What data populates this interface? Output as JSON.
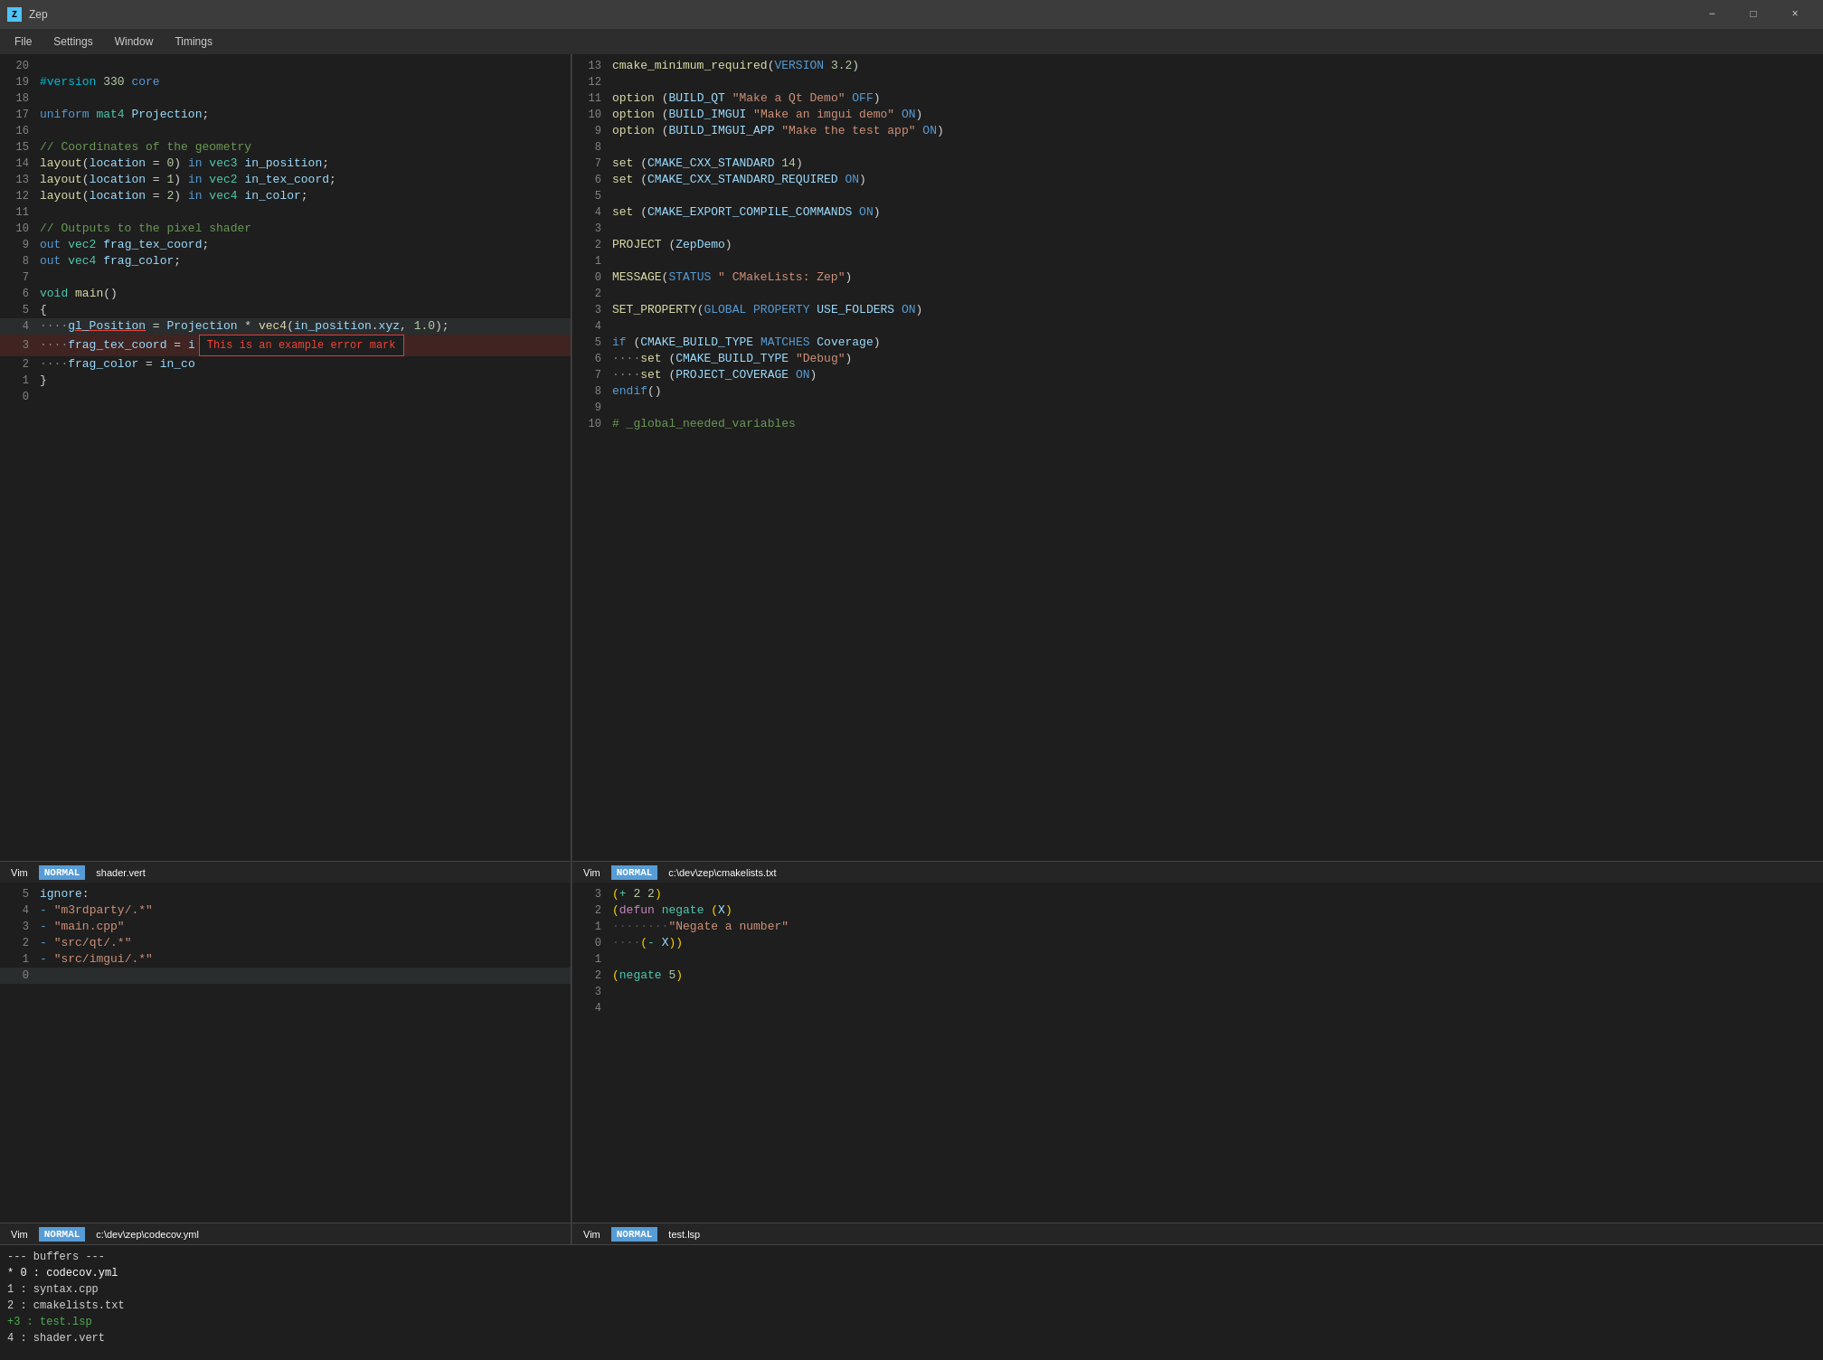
{
  "app": {
    "title": "Zep",
    "icon": "Z"
  },
  "menu": {
    "items": [
      "File",
      "Settings",
      "Window",
      "Timings"
    ]
  },
  "top_left_editor": {
    "lines": [
      {
        "num": "20",
        "content": ""
      },
      {
        "num": "19",
        "content": "#version 330 core",
        "type": "preprocessor"
      },
      {
        "num": "18",
        "content": ""
      },
      {
        "num": "17",
        "content": "uniform mat4 Projection;",
        "type": "code"
      },
      {
        "num": "16",
        "content": ""
      },
      {
        "num": "15",
        "content": "// Coordinates  of the geometry",
        "type": "comment"
      },
      {
        "num": "14",
        "content": "layout(location = 0) in vec3 in_position;",
        "type": "code"
      },
      {
        "num": "13",
        "content": "layout(location = 1) in vec2 in_tex_coord;",
        "type": "code"
      },
      {
        "num": "12",
        "content": "layout(location = 2) in vec4 in_color;",
        "type": "code"
      },
      {
        "num": "11",
        "content": ""
      },
      {
        "num": "10",
        "content": "// Outputs to the pixel shader",
        "type": "comment"
      },
      {
        "num": "9",
        "content": "out vec2 frag_tex_coord;",
        "type": "code"
      },
      {
        "num": "8",
        "content": "out vec4 frag_color;",
        "type": "code"
      },
      {
        "num": "7",
        "content": ""
      },
      {
        "num": "6",
        "content": "void main()",
        "type": "code"
      },
      {
        "num": "5",
        "content": "{",
        "type": "code"
      },
      {
        "num": "4",
        "content": "    gl_Position = Projection * vec4(in_position.xyz, 1.0);",
        "type": "code",
        "highlight": true
      },
      {
        "num": "3",
        "content": "    frag_tex_coord = i",
        "type": "code",
        "error": true,
        "tooltip": "This is an example error mark"
      },
      {
        "num": "2",
        "content": "    frag_color = in_co",
        "type": "code"
      },
      {
        "num": "1",
        "content": "}",
        "type": "code"
      },
      {
        "num": "0",
        "content": ""
      }
    ],
    "status": {
      "vim": "Vim",
      "mode": "NORMAL",
      "filename": "shader.vert"
    }
  },
  "top_right_editor": {
    "lines": [
      {
        "num": "13",
        "content": "cmake_minimum_required(VERSION 3.2)"
      },
      {
        "num": "12",
        "content": ""
      },
      {
        "num": "11",
        "content": "option (BUILD_QT \"Make a Qt Demo\" OFF)"
      },
      {
        "num": "10",
        "content": "option (BUILD_IMGUI \"Make an imgui demo\" ON)"
      },
      {
        "num": "9",
        "content": "option (BUILD_IMGUI_APP \"Make the test app\" ON)"
      },
      {
        "num": "8",
        "content": ""
      },
      {
        "num": "7",
        "content": "set (CMAKE_CXX_STANDARD 14)"
      },
      {
        "num": "6",
        "content": "set (CMAKE_CXX_STANDARD_REQUIRED ON)"
      },
      {
        "num": "5",
        "content": ""
      },
      {
        "num": "4",
        "content": "set (CMAKE_EXPORT_COMPILE_COMMANDS ON)"
      },
      {
        "num": "3",
        "content": ""
      },
      {
        "num": "2",
        "content": "PROJECT (ZepDemo)"
      },
      {
        "num": "1",
        "content": ""
      },
      {
        "num": "0",
        "content": "MESSAGE(STATUS \" CMakeLists: Zep\")"
      },
      {
        "num": "2",
        "content": ""
      },
      {
        "num": "3",
        "content": "SET_PROPERTY(GLOBAL PROPERTY USE_FOLDERS ON)"
      },
      {
        "num": "4",
        "content": ""
      },
      {
        "num": "5",
        "content": "if (CMAKE_BUILD_TYPE MATCHES Coverage)"
      },
      {
        "num": "6",
        "content": "    set (CMAKE_BUILD_TYPE \"Debug\")"
      },
      {
        "num": "7",
        "content": "    set (PROJECT_COVERAGE ON)"
      },
      {
        "num": "8",
        "content": "endif()"
      },
      {
        "num": "9",
        "content": ""
      },
      {
        "num": "10",
        "content": "# _global_needed_variables"
      }
    ],
    "status": {
      "vim": "Vim",
      "mode": "NORMAL",
      "filename": "c:\\dev\\zep\\cmakelists.txt"
    }
  },
  "bottom_left_editor": {
    "lines": [
      {
        "num": "5",
        "content": "ignore:"
      },
      {
        "num": "4",
        "content": "  - \"m3rdparty/.*\""
      },
      {
        "num": "3",
        "content": "  - \"main.cpp\""
      },
      {
        "num": "2",
        "content": "  - \"src/qt/.*\""
      },
      {
        "num": "1",
        "content": "  - \"src/imgui/.*\""
      },
      {
        "num": "0",
        "content": ""
      }
    ],
    "status": {
      "vim": "Vim",
      "mode": "NORMAL",
      "filename": "c:\\dev\\zep\\codecov.yml"
    }
  },
  "bottom_right_editor": {
    "lines": [
      {
        "num": "3",
        "content": "(+ 2 2)"
      },
      {
        "num": "2",
        "content": "(defun negate (X)"
      },
      {
        "num": "1",
        "content": "  ......  \"Negate a number\""
      },
      {
        "num": "0",
        "content": "  ....  (- X))"
      },
      {
        "num": "1",
        "content": ""
      },
      {
        "num": "2",
        "content": "(negate 5)"
      },
      {
        "num": "3",
        "content": ""
      },
      {
        "num": "4",
        "content": ""
      }
    ],
    "status": {
      "vim": "Vim",
      "mode": "NORMAL",
      "filename": "test.lsp"
    }
  },
  "bottom_panel": {
    "title": "--- buffers ---",
    "buffers": [
      {
        "num": "0",
        "name": "codecov.yml",
        "active": true
      },
      {
        "num": "1",
        "name": "syntax.cpp"
      },
      {
        "num": "2",
        "name": "cmakelists.txt"
      },
      {
        "num": "3",
        "name": "test.lsp",
        "modified": true
      },
      {
        "num": "4",
        "name": "shader.vert"
      }
    ]
  },
  "window": {
    "controls": {
      "minimize": "−",
      "maximize": "□",
      "close": "×"
    }
  }
}
